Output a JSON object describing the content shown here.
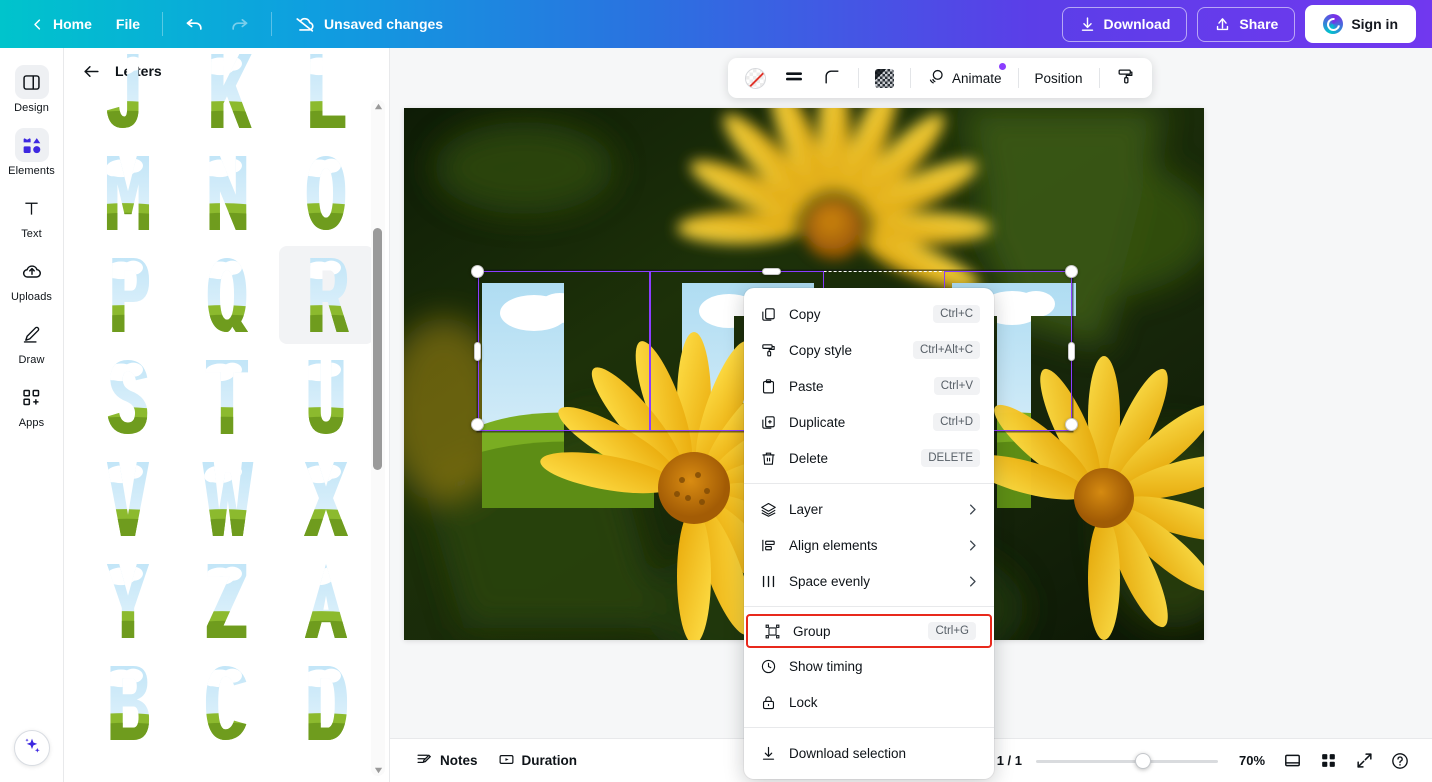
{
  "topbar": {
    "home_label": "Home",
    "file_label": "File",
    "undo_name": "undo",
    "redo_name": "redo",
    "status_label": "Unsaved changes",
    "download_label": "Download",
    "share_label": "Share",
    "signin_label": "Sign in"
  },
  "rail": {
    "items": [
      {
        "label": "Design",
        "icon": "design-icon",
        "active": false
      },
      {
        "label": "Elements",
        "icon": "elements-icon",
        "active": true
      },
      {
        "label": "Text",
        "icon": "text-icon",
        "active": false
      },
      {
        "label": "Uploads",
        "icon": "uploads-icon",
        "active": false
      },
      {
        "label": "Draw",
        "icon": "draw-icon",
        "active": false
      },
      {
        "label": "Apps",
        "icon": "apps-icon",
        "active": false
      }
    ],
    "magic_icon": "sparkle-icon"
  },
  "panel": {
    "title": "Letters",
    "back_icon": "arrow-left-icon",
    "letters": [
      {
        "char": "J",
        "hovered": false
      },
      {
        "char": "K",
        "hovered": false
      },
      {
        "char": "L",
        "hovered": false
      },
      {
        "char": "M",
        "hovered": false
      },
      {
        "char": "N",
        "hovered": false
      },
      {
        "char": "O",
        "hovered": false
      },
      {
        "char": "P",
        "hovered": false
      },
      {
        "char": "Q",
        "hovered": false
      },
      {
        "char": "R",
        "hovered": true
      },
      {
        "char": "S",
        "hovered": false
      },
      {
        "char": "T",
        "hovered": false
      },
      {
        "char": "U",
        "hovered": false
      },
      {
        "char": "V",
        "hovered": false
      },
      {
        "char": "W",
        "hovered": false
      },
      {
        "char": "X",
        "hovered": false
      },
      {
        "char": "Y",
        "hovered": false
      },
      {
        "char": "Z",
        "hovered": false
      },
      {
        "char": "A",
        "hovered": false
      },
      {
        "char": "B",
        "hovered": false
      },
      {
        "char": "C",
        "hovered": false
      },
      {
        "char": "D",
        "hovered": false
      }
    ]
  },
  "element_toolbar": {
    "color_swatch": "no-color-swatch",
    "line_weight": "line-weight-icon",
    "corner_radius": "corner-radius-icon",
    "transparency": "transparency-icon",
    "animate_label": "Animate",
    "animate_badge": true,
    "position_label": "Position",
    "paint_roller": "paint-roller-icon"
  },
  "canvas": {
    "letters": [
      "L",
      "E",
      "T"
    ],
    "sky_color": "#bfe4f5",
    "grass_color": "#6f9c1e",
    "selection_accent": "#8b3dff"
  },
  "context_menu": {
    "groups": [
      {
        "items": [
          {
            "label": "Copy",
            "shortcut": "Ctrl+C",
            "icon": "copy-icon",
            "submenu": false,
            "flagged": false
          },
          {
            "label": "Copy style",
            "shortcut": "Ctrl+Alt+C",
            "icon": "copy-style-icon",
            "submenu": false,
            "flagged": false
          },
          {
            "label": "Paste",
            "shortcut": "Ctrl+V",
            "icon": "paste-icon",
            "submenu": false,
            "flagged": false
          },
          {
            "label": "Duplicate",
            "shortcut": "Ctrl+D",
            "icon": "duplicate-icon",
            "submenu": false,
            "flagged": false
          },
          {
            "label": "Delete",
            "shortcut": "DELETE",
            "icon": "trash-icon",
            "submenu": false,
            "flagged": false
          }
        ]
      },
      {
        "items": [
          {
            "label": "Layer",
            "shortcut": "",
            "icon": "layers-icon",
            "submenu": true,
            "flagged": false
          },
          {
            "label": "Align elements",
            "shortcut": "",
            "icon": "align-icon",
            "submenu": true,
            "flagged": false
          },
          {
            "label": "Space evenly",
            "shortcut": "",
            "icon": "space-evenly-icon",
            "submenu": true,
            "flagged": false
          }
        ]
      },
      {
        "items": [
          {
            "label": "Group",
            "shortcut": "Ctrl+G",
            "icon": "group-icon",
            "submenu": false,
            "flagged": true
          },
          {
            "label": "Show timing",
            "shortcut": "",
            "icon": "clock-icon",
            "submenu": false,
            "flagged": false
          },
          {
            "label": "Lock",
            "shortcut": "",
            "icon": "lock-icon",
            "submenu": false,
            "flagged": false
          }
        ]
      },
      {
        "items": [
          {
            "label": "Download selection",
            "shortcut": "",
            "icon": "download-icon",
            "submenu": false,
            "flagged": false
          }
        ]
      }
    ],
    "highlight_color": "#e8291c"
  },
  "bottombar": {
    "notes_label": "Notes",
    "duration_label": "Duration",
    "page_label": "e 1 / 1",
    "zoom_value": "70%",
    "icons": [
      "page-view-icon",
      "grid-view-icon",
      "fullscreen-icon",
      "help-icon"
    ]
  }
}
